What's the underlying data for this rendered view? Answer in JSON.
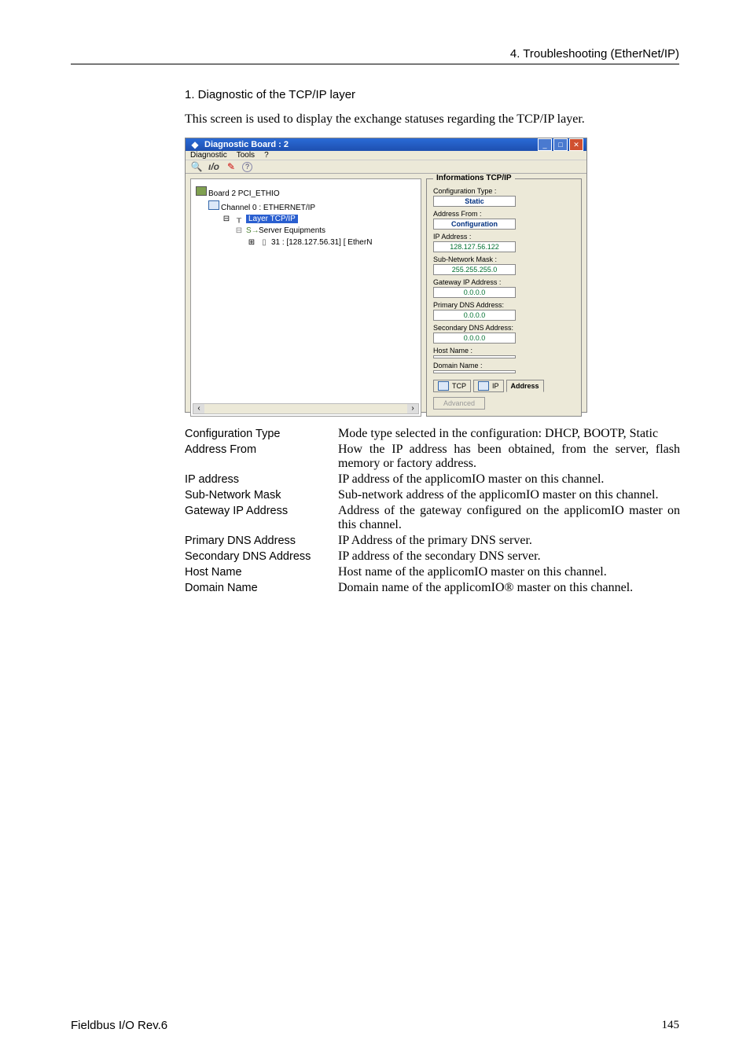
{
  "header": {
    "chapter": "4. Troubleshooting (EtherNet/IP)"
  },
  "section": {
    "title": "1. Diagnostic of the TCP/IP layer",
    "intro": "This screen is used to display the exchange statuses regarding the TCP/IP layer."
  },
  "dialog": {
    "title": "Diagnostic Board : 2",
    "menu": {
      "diagnostic": "Diagnostic",
      "tools": "Tools",
      "help": "?"
    },
    "tree": {
      "board": "Board 2 PCI_ETHIO",
      "channel": "Channel 0 : ETHERNET/IP",
      "layer": "Layer TCP/IP",
      "server": "Server Equipments",
      "node": "31 : [128.127.56.31] [ EtherN"
    },
    "info": {
      "group": "Informations TCP/IP",
      "cfgtype_label": "Configuration Type :",
      "cfgtype_value": "Static",
      "addrfrom_label": "Address From :",
      "addrfrom_value": "Configuration",
      "ip_label": "IP Address :",
      "ip_value": "128.127.56.122",
      "mask_label": "Sub-Network Mask :",
      "mask_value": "255.255.255.0",
      "gw_label": "Gateway IP Address :",
      "gw_value": "0.0.0.0",
      "pdns_label": "Primary DNS Address:",
      "pdns_value": "0.0.0.0",
      "sdns_label": "Secondary DNS Address:",
      "sdns_value": "0.0.0.0",
      "host_label": "Host Name :",
      "host_value": "",
      "domain_label": "Domain Name :",
      "domain_value": "",
      "tab_tcp": "TCP",
      "tab_ip": "IP",
      "tab_addr": "Address",
      "advanced": "Advanced"
    }
  },
  "defs": [
    {
      "term": "Configuration Type",
      "def": "Mode type selected in the configuration: DHCP, BOOTP, Static"
    },
    {
      "term": "Address From",
      "def": "How the IP address has been obtained, from the server, flash memory or factory address."
    },
    {
      "term": "IP address",
      "def": "IP address of the applicomIO master on this channel."
    },
    {
      "term": "Sub-Network Mask",
      "def": "Sub-network address of the applicomIO master on this channel."
    },
    {
      "term": "Gateway IP Address",
      "def": "Address of the gateway configured on the applicomIO master on this channel."
    },
    {
      "term": "Primary DNS Address",
      "def": "IP Address of the primary DNS server."
    },
    {
      "term": "Secondary DNS Address",
      "def": "IP address of the secondary DNS server."
    },
    {
      "term": "Host Name",
      "def": "Host name of the applicomIO master on this channel."
    },
    {
      "term": "Domain Name",
      "def": "Domain name of the applicomIO® master on this channel."
    }
  ],
  "footer": {
    "left": "Fieldbus I/O Rev.6",
    "right": "145"
  }
}
